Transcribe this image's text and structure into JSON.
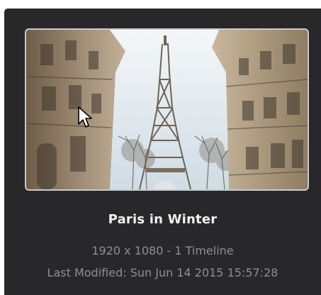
{
  "project": {
    "name": "Paris in Winter",
    "details": "1920 x 1080 - 1 Timeline",
    "last_modified": "Last Modified: Sun Jun 14 2015 15:57:28"
  },
  "colors": {
    "panel_bg": "#28282b",
    "title_text": "#f2f2f2",
    "meta_text": "#8f8f8f",
    "thumbnail_border": "#c9c9c9"
  },
  "icons": {
    "pointer": "mouse-pointer-icon"
  }
}
